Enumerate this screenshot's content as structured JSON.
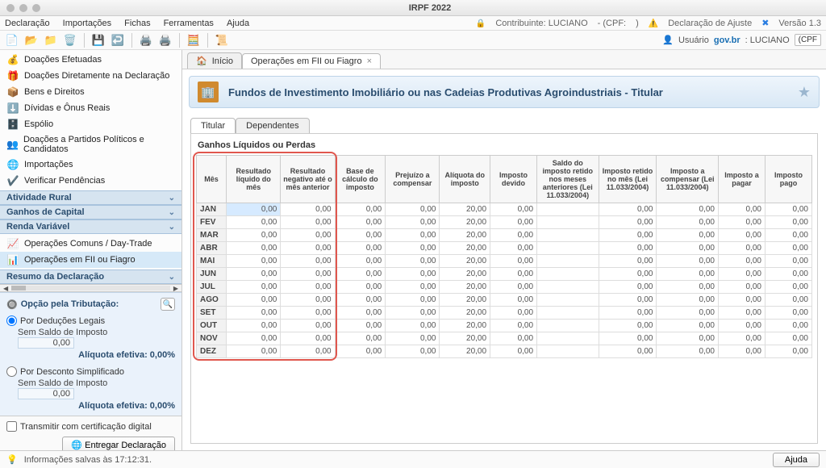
{
  "window": {
    "title": "IRPF 2022"
  },
  "menubar": {
    "items": [
      "Declaração",
      "Importações",
      "Fichas",
      "Ferramentas",
      "Ajuda"
    ],
    "contribuinte_label": "Contribuinte: LUCIANO",
    "cpf_label": "- (CPF:",
    "cpf_close": ")",
    "decl_type": "Declaração de Ajuste",
    "version": "Versão 1.3"
  },
  "toolbar": {
    "user_label": "Usuário",
    "user_domain": "gov.br",
    "user_name": ": LUCIANO",
    "cpf_prefix": "(CPF"
  },
  "sidebar": {
    "fichas": [
      {
        "icon": "💰",
        "label": "Doações Efetuadas"
      },
      {
        "icon": "🎁",
        "label": "Doações Diretamente na Declaração"
      },
      {
        "icon": "📦",
        "label": "Bens e Direitos"
      },
      {
        "icon": "⬇️",
        "label": "Dívidas e Ônus Reais"
      },
      {
        "icon": "🗄️",
        "label": "Espólio"
      },
      {
        "icon": "👥",
        "label": "Doações a Partidos Políticos e Candidatos"
      },
      {
        "icon": "🌐",
        "label": "Importações"
      },
      {
        "icon": "✔️",
        "label": "Verificar Pendências"
      }
    ],
    "sections": {
      "rural": "Atividade Rural",
      "ganhos": "Ganhos de Capital",
      "renda": "Renda Variável",
      "resumo": "Resumo da Declaração"
    },
    "renda_items": [
      {
        "icon": "📈",
        "label": "Operações Comuns / Day-Trade"
      },
      {
        "icon": "📊",
        "label": "Operações em FII ou Fiagro",
        "selected": true
      }
    ],
    "tax": {
      "header": "Opção pela Tributação:",
      "opt1": "Por Deduções Legais",
      "sub": "Sem Saldo de Imposto",
      "val": "0,00",
      "eff": "Alíquota efetiva: 0,00%",
      "opt2": "Por Desconto Simplificado"
    },
    "transmit_check": "Transmitir com certificação digital",
    "transmit_btn": "Entregar Declaração"
  },
  "tabs": {
    "home": "Início",
    "current": "Operações em FII ou Fiagro"
  },
  "page": {
    "title": "Fundos de Investimento Imobiliário ou nas Cadeias Produtivas Agroindustriais - Titular",
    "inner_tabs": [
      "Titular",
      "Dependentes"
    ],
    "table_title": "Ganhos Líquidos ou Perdas"
  },
  "table": {
    "headers": [
      "Mês",
      "Resultado líquido do mês",
      "Resultado negativo até o mês anterior",
      "Base de cálculo do imposto",
      "Prejuízo a compensar",
      "Alíquota do imposto",
      "Imposto devido",
      "Saldo do imposto retido nos meses anteriores (Lei 11.033/2004)",
      "Imposto retido no mês (Lei 11.033/2004)",
      "Imposto a compensar (Lei 11.033/2004)",
      "Imposto a pagar",
      "Imposto pago"
    ],
    "months": [
      "JAN",
      "FEV",
      "MAR",
      "ABR",
      "MAI",
      "JUN",
      "JUL",
      "AGO",
      "SET",
      "OUT",
      "NOV",
      "DEZ"
    ],
    "cell_default": "0,00",
    "aliquota": "20,00",
    "jan_result": "0,00"
  },
  "status": {
    "text": "Informações salvas às 17:12:31.",
    "help": "Ajuda"
  },
  "chart_data": {
    "type": "table",
    "title": "Ganhos Líquidos ou Perdas",
    "columns": [
      "Mês",
      "Resultado líquido do mês",
      "Resultado negativo até o mês anterior",
      "Base de cálculo do imposto",
      "Prejuízo a compensar",
      "Alíquota do imposto",
      "Imposto devido",
      "Saldo do imposto retido nos meses anteriores (Lei 11.033/2004)",
      "Imposto retido no mês (Lei 11.033/2004)",
      "Imposto a compensar (Lei 11.033/2004)",
      "Imposto a pagar",
      "Imposto pago"
    ],
    "rows": [
      [
        "JAN",
        0.0,
        0.0,
        0.0,
        0.0,
        20.0,
        0.0,
        null,
        0.0,
        0.0,
        0.0,
        0.0
      ],
      [
        "FEV",
        0.0,
        0.0,
        0.0,
        0.0,
        20.0,
        0.0,
        null,
        0.0,
        0.0,
        0.0,
        0.0
      ],
      [
        "MAR",
        0.0,
        0.0,
        0.0,
        0.0,
        20.0,
        0.0,
        null,
        0.0,
        0.0,
        0.0,
        0.0
      ],
      [
        "ABR",
        0.0,
        0.0,
        0.0,
        0.0,
        20.0,
        0.0,
        null,
        0.0,
        0.0,
        0.0,
        0.0
      ],
      [
        "MAI",
        0.0,
        0.0,
        0.0,
        0.0,
        20.0,
        0.0,
        null,
        0.0,
        0.0,
        0.0,
        0.0
      ],
      [
        "JUN",
        0.0,
        0.0,
        0.0,
        0.0,
        20.0,
        0.0,
        null,
        0.0,
        0.0,
        0.0,
        0.0
      ],
      [
        "JUL",
        0.0,
        0.0,
        0.0,
        0.0,
        20.0,
        0.0,
        null,
        0.0,
        0.0,
        0.0,
        0.0
      ],
      [
        "AGO",
        0.0,
        0.0,
        0.0,
        0.0,
        20.0,
        0.0,
        null,
        0.0,
        0.0,
        0.0,
        0.0
      ],
      [
        "SET",
        0.0,
        0.0,
        0.0,
        0.0,
        20.0,
        0.0,
        null,
        0.0,
        0.0,
        0.0,
        0.0
      ],
      [
        "OUT",
        0.0,
        0.0,
        0.0,
        0.0,
        20.0,
        0.0,
        null,
        0.0,
        0.0,
        0.0,
        0.0
      ],
      [
        "NOV",
        0.0,
        0.0,
        0.0,
        0.0,
        20.0,
        0.0,
        null,
        0.0,
        0.0,
        0.0,
        0.0
      ],
      [
        "DEZ",
        0.0,
        0.0,
        0.0,
        0.0,
        20.0,
        0.0,
        null,
        0.0,
        0.0,
        0.0,
        0.0
      ]
    ]
  }
}
